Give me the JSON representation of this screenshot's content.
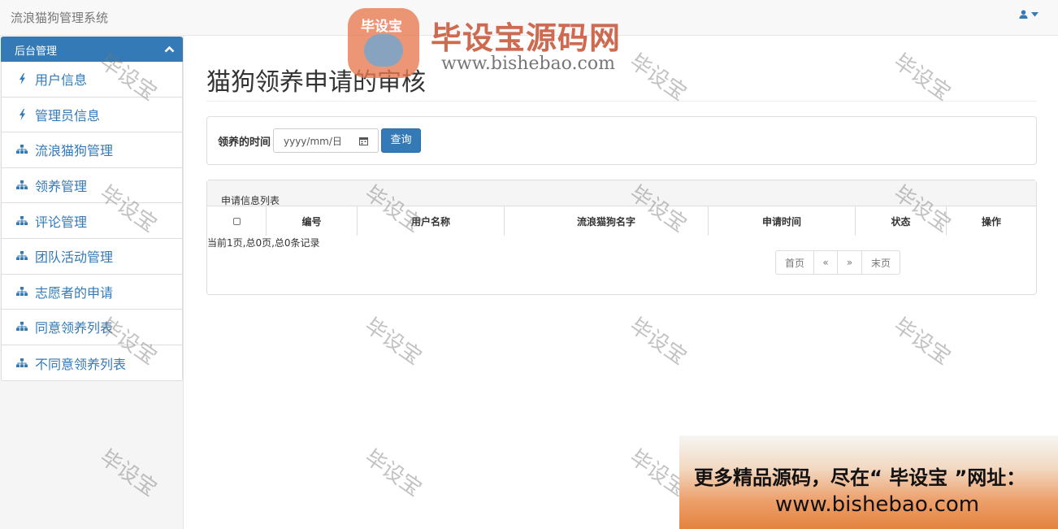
{
  "app": {
    "brand": "流浪猫狗管理系统"
  },
  "navbar": {
    "user_icon": "user-icon",
    "caret_icon": "caret-down-icon"
  },
  "sidebar": {
    "header": "后台管理",
    "items": [
      {
        "label": "用户信息",
        "icon": "bolt-icon"
      },
      {
        "label": "管理员信息",
        "icon": "bolt-icon"
      },
      {
        "label": "流浪猫狗管理",
        "icon": "sitemap-icon"
      },
      {
        "label": "领养管理",
        "icon": "sitemap-icon"
      },
      {
        "label": "评论管理",
        "icon": "sitemap-icon"
      },
      {
        "label": "团队活动管理",
        "icon": "sitemap-icon"
      },
      {
        "label": "志愿者的申请",
        "icon": "sitemap-icon"
      },
      {
        "label": "同意领养列表",
        "icon": "sitemap-icon"
      },
      {
        "label": "不同意领养列表",
        "icon": "sitemap-icon"
      }
    ]
  },
  "page": {
    "title": "猫狗领养申请的审核"
  },
  "search": {
    "label": "领养的时间",
    "date_placeholder": "yyyy/mm/日",
    "query_button": "查询"
  },
  "list": {
    "heading": "申请信息列表",
    "columns": [
      "编号",
      "用户名称",
      "流浪猫狗名字",
      "申请时间",
      "状态",
      "操作"
    ],
    "record_info": "当前1页,总0页,总0条记录"
  },
  "pagination": {
    "first": "首页",
    "prev": "«",
    "next": "»",
    "last": "末页"
  },
  "watermark": {
    "text": "毕设宝",
    "logo_badge": "毕设宝",
    "logo_title": "毕设宝源码网",
    "logo_url": "www.bishebao.com"
  },
  "banner": {
    "line1": "更多精品源码，尽在“ 毕设宝 ”网址：",
    "line2": "www.bishebao.com"
  },
  "colors": {
    "primary": "#337ab7",
    "navbar_bg": "#f8f8f8",
    "sidebar_bg": "#f5f5f5"
  }
}
